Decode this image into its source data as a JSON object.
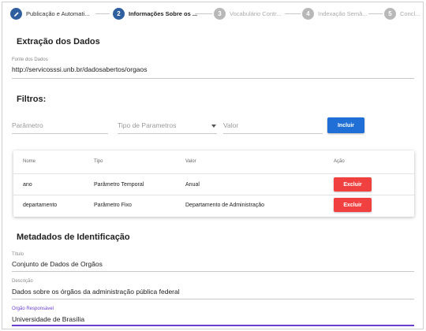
{
  "stepper": {
    "steps": [
      {
        "number": "",
        "label": "Publicação e Automati...",
        "state": "done"
      },
      {
        "number": "2",
        "label": "Informações Sobre os ...",
        "state": "active"
      },
      {
        "number": "3",
        "label": "Vocabulário Contr...",
        "state": "inactive"
      },
      {
        "number": "4",
        "label": "Indexação Semâ...",
        "state": "inactive"
      },
      {
        "number": "5",
        "label": "Concl...",
        "state": "inactive"
      }
    ]
  },
  "extracao": {
    "title": "Extração dos Dados",
    "fonte_label": "Fonte dos Dados",
    "fonte_value": "http://servicosssi.unb.br/dadosabertos/orgaos"
  },
  "filtros": {
    "title": "Filtros:",
    "parametro_placeholder": "Parâmetro",
    "tipo_placeholder": "Tipo de Parametros",
    "valor_placeholder": "Valor",
    "incluir_label": "Incluir"
  },
  "table": {
    "headers": [
      "Nome",
      "Tipo",
      "Valor",
      "Ação"
    ],
    "rows": [
      {
        "nome": "ano",
        "tipo": "Parâmetro Temporal",
        "valor": "Anual",
        "acao": "Excluir"
      },
      {
        "nome": "departamento",
        "tipo": "Parâmetro Fixo",
        "valor": "Departamento de Administração",
        "acao": "Excluir"
      }
    ]
  },
  "metadados": {
    "title": "Metadados de Identificação",
    "titulo_label": "Título",
    "titulo_value": "Conjunto de Dados de Orgãos",
    "descricao_label": "Descrição",
    "descricao_value": "Dados sobre os órgãos da administração pública federal",
    "orgao_label": "Orgão Responsável",
    "orgao_value": "Universidade de Brasília"
  },
  "colors": {
    "primary": "#1f6fd6",
    "danger": "#f04040",
    "step": "#2f5f9e",
    "focus": "#6a3fd1"
  }
}
